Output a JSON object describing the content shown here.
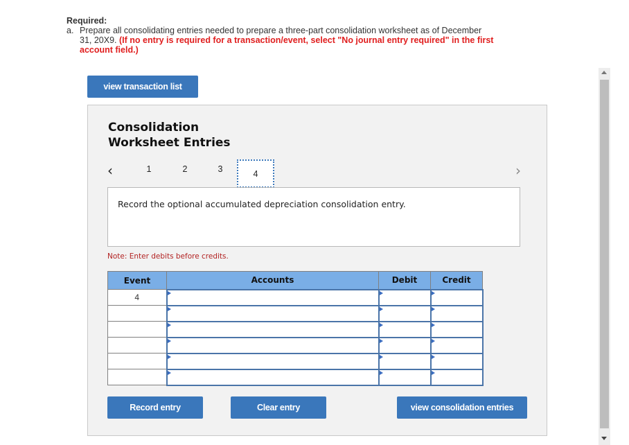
{
  "required": {
    "title": "Required:",
    "letter": "a.",
    "text": "Prepare all consolidating entries needed to prepare a three-part consolidation worksheet as of December 31, 20X9.",
    "emphasis": "(If no entry is required for a transaction/event, select \"No journal entry required\" in the first account field.)"
  },
  "buttons": {
    "view_transaction_list": "view transaction list",
    "record_entry": "Record entry",
    "clear_entry": "Clear entry",
    "view_consolidation_entries": "view consolidation entries"
  },
  "panel": {
    "title_line1": "Consolidation",
    "title_line2": "Worksheet Entries",
    "pager": {
      "prev_icon": "chevron-left-icon",
      "next_icon": "chevron-right-icon",
      "pages": [
        "1",
        "2",
        "3",
        "4"
      ],
      "active_page": "4"
    },
    "prompt": "Record the optional accumulated depreciation consolidation entry.",
    "note": "Note: Enter debits before credits."
  },
  "table": {
    "headers": [
      "Event",
      "Accounts",
      "Debit",
      "Credit"
    ],
    "rows": [
      {
        "event": "4",
        "account": "",
        "debit": "",
        "credit": ""
      },
      {
        "event": "",
        "account": "",
        "debit": "",
        "credit": ""
      },
      {
        "event": "",
        "account": "",
        "debit": "",
        "credit": ""
      },
      {
        "event": "",
        "account": "",
        "debit": "",
        "credit": ""
      },
      {
        "event": "",
        "account": "",
        "debit": "",
        "credit": ""
      },
      {
        "event": "",
        "account": "",
        "debit": "",
        "credit": ""
      }
    ]
  },
  "colors": {
    "button_blue": "#3a77bb",
    "header_blue": "#7aaee6",
    "emphasis_red": "#e01e1e",
    "note_red": "#b22222"
  }
}
